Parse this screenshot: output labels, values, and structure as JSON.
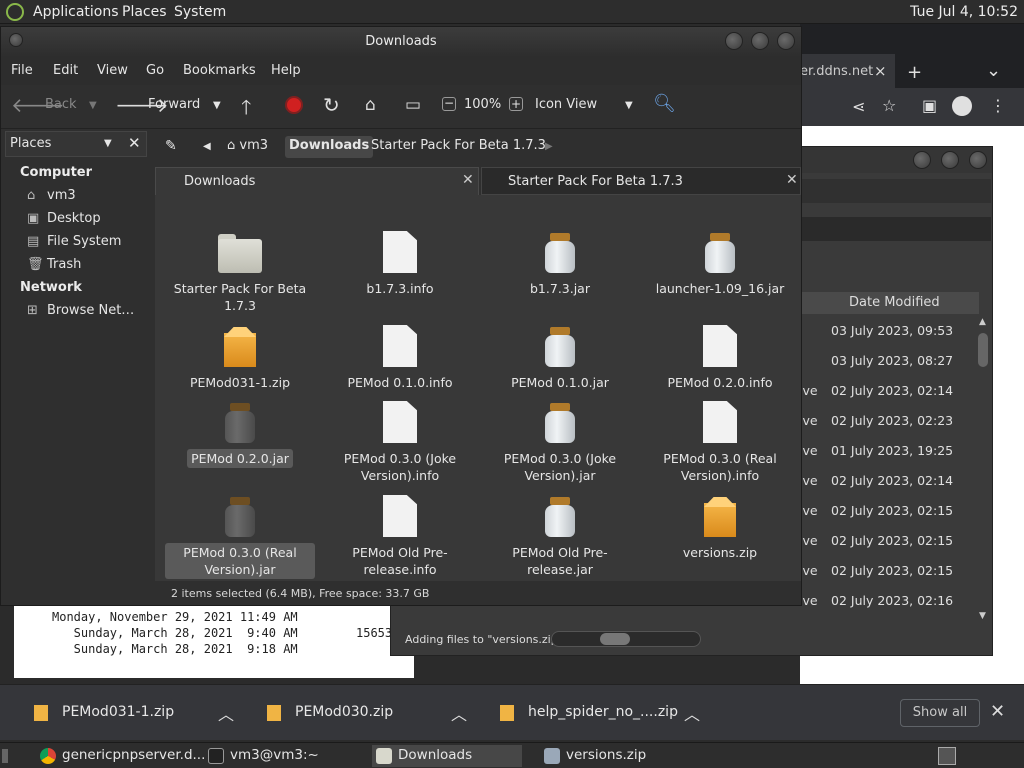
{
  "panel": {
    "menus": [
      "Applications",
      "Places",
      "System"
    ],
    "clock": "Tue Jul  4, 10:52"
  },
  "chrome": {
    "tab_fragment": "er.ddns.net",
    "tab_close": "×",
    "new_tab": "+",
    "tabs_menu": "⌄"
  },
  "terminal": {
    "lines": [
      "Monday, November 29, 2021 11:49 AM",
      "   Sunday, March 28, 2021  9:40 AM",
      "   Sunday, March 28, 2021  9:18 AM"
    ],
    "size_fragment": "15653"
  },
  "archive": {
    "date_header": "Date Modified",
    "rows": [
      {
        "type": "",
        "date": "03 July 2023, 09:53"
      },
      {
        "type": "",
        "date": "03 July 2023, 08:27"
      },
      {
        "type": "ive",
        "date": "02 July 2023, 02:14"
      },
      {
        "type": "ive",
        "date": "02 July 2023, 02:23"
      },
      {
        "type": "ive",
        "date": "01 July 2023, 19:25"
      },
      {
        "type": "ive",
        "date": "02 July 2023, 02:14"
      },
      {
        "type": "ive",
        "date": "02 July 2023, 02:15"
      },
      {
        "type": "ive",
        "date": "02 July 2023, 02:15"
      },
      {
        "type": "ive",
        "date": "02 July 2023, 02:15"
      },
      {
        "type": "ive",
        "date": "02 July 2023, 02:16"
      }
    ],
    "status": "Adding files to \"versions.zip\"",
    "progress": 0.4
  },
  "fm": {
    "title": "Downloads",
    "menus": [
      "File",
      "Edit",
      "View",
      "Go",
      "Bookmarks",
      "Help"
    ],
    "toolbar": {
      "back": "Back",
      "forward": "Forward",
      "zoom": "100%",
      "view_mode": "Icon View"
    },
    "sidebar": {
      "header": "Places",
      "sections": [
        {
          "title": "Computer",
          "items": [
            "vm3",
            "Desktop",
            "File System",
            "Trash"
          ]
        },
        {
          "title": "Network",
          "items": [
            "Browse Net…"
          ]
        }
      ]
    },
    "breadcrumb": [
      "vm3",
      "Downloads",
      "Starter Pack For Beta 1.7.3"
    ],
    "tabs": [
      "Downloads",
      "Starter Pack For Beta 1.7.3"
    ],
    "files": [
      {
        "name": "Starter Pack For Beta 1.7.3",
        "kind": "folder",
        "selected": false
      },
      {
        "name": "b1.7.3.info",
        "kind": "doc",
        "selected": false
      },
      {
        "name": "b1.7.3.jar",
        "kind": "jar",
        "selected": false
      },
      {
        "name": "launcher-1.09_16.jar",
        "kind": "jar",
        "selected": false
      },
      {
        "name": "PEMod031-1.zip",
        "kind": "zip",
        "selected": false
      },
      {
        "name": "PEMod 0.1.0.info",
        "kind": "doc",
        "selected": false
      },
      {
        "name": "PEMod 0.1.0.jar",
        "kind": "jar",
        "selected": false
      },
      {
        "name": "PEMod 0.2.0.info",
        "kind": "doc",
        "selected": false
      },
      {
        "name": "PEMod 0.2.0.jar",
        "kind": "jar",
        "selected": true
      },
      {
        "name": "PEMod 0.3.0 (Joke Version).info",
        "kind": "doc",
        "selected": false
      },
      {
        "name": "PEMod 0.3.0 (Joke Version).jar",
        "kind": "jar",
        "selected": false
      },
      {
        "name": "PEMod 0.3.0 (Real Version).info",
        "kind": "doc",
        "selected": false
      },
      {
        "name": "PEMod 0.3.0 (Real Version).jar",
        "kind": "jar",
        "selected": true
      },
      {
        "name": "PEMod Old Pre-release.info",
        "kind": "doc",
        "selected": false
      },
      {
        "name": "PEMod Old Pre-release.jar",
        "kind": "jar",
        "selected": false
      },
      {
        "name": "versions.zip",
        "kind": "zip",
        "selected": false
      }
    ],
    "status": "2 items selected (6.4 MB), Free space: 33.7 GB"
  },
  "downloads_bar": {
    "items": [
      "PEMod031-1.zip",
      "PEMod030.zip",
      "help_spider_no_....zip"
    ],
    "show_all": "Show all",
    "close": "✕"
  },
  "taskbar": {
    "items": [
      "genericpnpserver.d...",
      "vm3@vm3:~",
      "Downloads",
      "versions.zip"
    ]
  }
}
